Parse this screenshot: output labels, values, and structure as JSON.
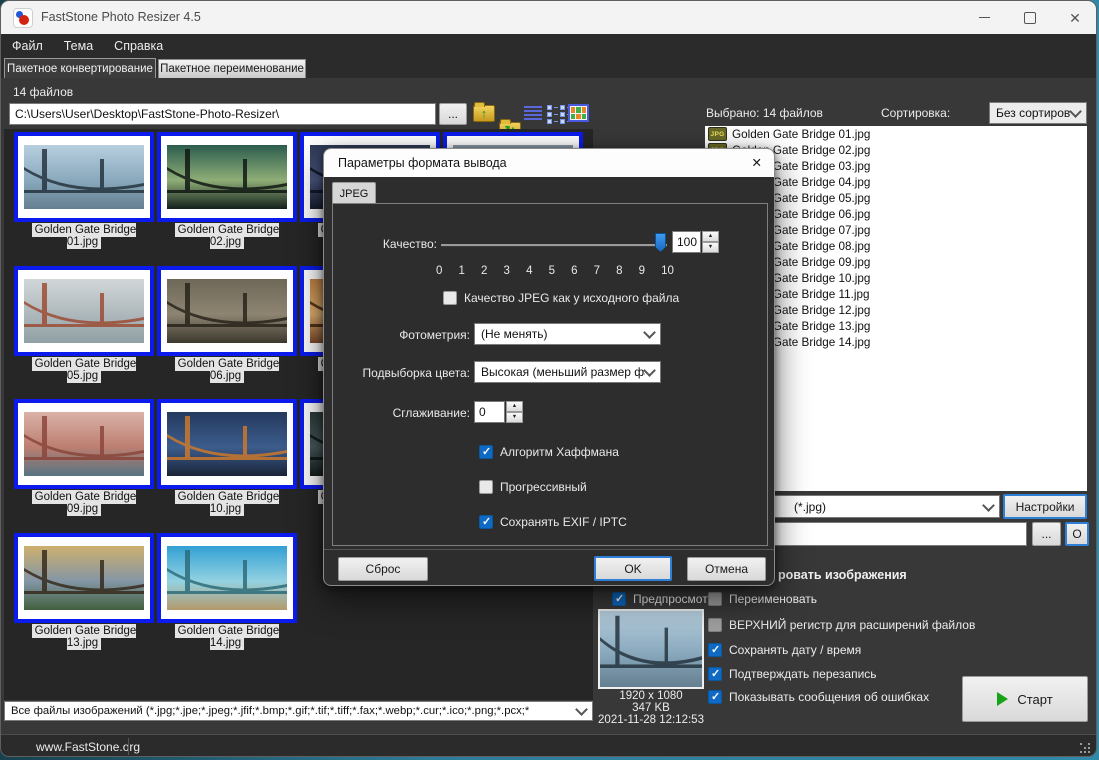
{
  "window": {
    "title": "FastStone Photo Resizer 4.5"
  },
  "menu": {
    "items": [
      "Файл",
      "Тема",
      "Справка"
    ]
  },
  "tabs": {
    "active": "Пакетное конвертирование",
    "inactive": "Пакетное переименование"
  },
  "browser": {
    "count_label": "14 файлов",
    "path": "C:\\Users\\User\\Desktop\\FastStone-Photo-Resizer\\",
    "browse_label": "...",
    "filter": "Все файлы изображений (*.jpg;*.jpe;*.jpeg;*.jfif;*.bmp;*.gif;*.tif;*.tiff;*.fax;*.webp;*.cur;*.ico;*.png;*.pcx;*"
  },
  "files": [
    {
      "name": "Golden Gate Bridge 01.jpg",
      "sky": "#b7cfdf",
      "mid": "#8aa9bd",
      "water": "#647f90",
      "fg": "#22313c"
    },
    {
      "name": "Golden Gate Bridge 02.jpg",
      "sky": "#2b5c4e",
      "mid": "#8fae77",
      "water": "#14201b",
      "fg": "#0e1511"
    },
    {
      "name": "Golden Gate Bridge 03.jpg",
      "sky": "#2e3a56",
      "mid": "#4a5680",
      "water": "#161c2e",
      "fg": "#0d1220"
    },
    {
      "name": "Golden Gate Bridge 04.jpg",
      "sky": "#8c9cac",
      "mid": "#6a7a8a",
      "water": "#46566a",
      "fg": "#2a3442"
    },
    {
      "name": "Golden Gate Bridge 05.jpg",
      "sky": "#d2d7d9",
      "mid": "#aeb8bc",
      "water": "#90a0a4",
      "fg": "#9c4a30"
    },
    {
      "name": "Golden Gate Bridge 06.jpg",
      "sky": "#6e6858",
      "mid": "#8e8472",
      "water": "#3c382e",
      "fg": "#262218"
    },
    {
      "name": "Golden Gate Bridge 07.jpg",
      "sky": "#c08448",
      "mid": "#e0b070",
      "water": "#7a4a2a",
      "fg": "#3c2210"
    },
    {
      "name": "Golden Gate Bridge 08.jpg",
      "sky": "#9aa2b2",
      "mid": "#788292",
      "water": "#525c6c",
      "fg": "#303844"
    },
    {
      "name": "Golden Gate Bridge 09.jpg",
      "sky": "#dab2a8",
      "mid": "#bc7e70",
      "water": "#567482",
      "fg": "#8a4438"
    },
    {
      "name": "Golden Gate Bridge 10.jpg",
      "sky": "#243a5e",
      "mid": "#3c5c8c",
      "water": "#1a2438",
      "fg": "#d07a2a"
    },
    {
      "name": "Golden Gate Bridge 11.jpg",
      "sky": "#2c3c3a",
      "mid": "#485a5e",
      "water": "#161e1e",
      "fg": "#0c1212"
    },
    {
      "name": "Golden Gate Bridge 12.jpg",
      "sky": "#8890a0",
      "mid": "#687080",
      "water": "#485060",
      "fg": "#2c3440"
    },
    {
      "name": "Golden Gate Bridge 13.jpg",
      "sky": "#cdb06e",
      "mid": "#8496a6",
      "water": "#41603e",
      "fg": "#34281a"
    },
    {
      "name": "Golden Gate Bridge 14.jpg",
      "sky": "#33a0d4",
      "mid": "#93d2e2",
      "water": "#b49a6c",
      "fg": "#2a6a78"
    }
  ],
  "selected": {
    "label": "Выбрано:  14 файлов",
    "sort_label": "Сортировка:",
    "sort_value": "Без сортиров"
  },
  "output": {
    "format_value": "(*.jpg)",
    "settings_label": "Настройки",
    "browse_label": "...",
    "open_label": "O",
    "convert_fragment": "ровать изображения"
  },
  "preview": {
    "label": "Предпросмотр",
    "checked": true,
    "dimensions": "1920 x 1080",
    "size": "347 KB",
    "datetime": "2021-11-28 12:12:53"
  },
  "options": [
    {
      "label": "Переименовать",
      "checked": false
    },
    {
      "label": "ВЕРХНИЙ регистр для расширений файлов",
      "checked": false
    },
    {
      "label": "Сохранять дату / время",
      "checked": true
    },
    {
      "label": "Подтверждать перезапись",
      "checked": true
    },
    {
      "label": "Показывать сообщения об ошибках",
      "checked": true
    }
  ],
  "start": {
    "label": "Старт"
  },
  "statusbar": {
    "url": "www.FastStone.org"
  },
  "dialog": {
    "title": "Параметры формата вывода",
    "tab": "JPEG",
    "quality_label": "Качество:",
    "quality_value": "100",
    "ticks": [
      "0",
      "1",
      "2",
      "3",
      "4",
      "5",
      "6",
      "7",
      "8",
      "9",
      "10"
    ],
    "same_quality": {
      "label": "Качество JPEG как у исходного файла",
      "checked": false
    },
    "photometry": {
      "label": "Фотометрия:",
      "value": "(Не менять)"
    },
    "subsampling": {
      "label": "Подвыборка цвета:",
      "value": "Высокая (меньший размер фай."
    },
    "smoothing": {
      "label": "Сглаживание:",
      "value": "0"
    },
    "huffman": {
      "label": "Алгоритм Хаффмана",
      "checked": true
    },
    "progressive": {
      "label": "Прогрессивный",
      "checked": false
    },
    "exif": {
      "label": "Сохранять EXIF / IPTC",
      "checked": true
    },
    "reset_label": "Сброс",
    "ok_label": "OK",
    "cancel_label": "Отмена"
  },
  "colors": {
    "accent_blue": "#0e6ac4",
    "selection_border": "#0b1bee",
    "play_green": "#17a317",
    "titlebar_bg": "#f3f3f3",
    "panel_dark": "#383838"
  }
}
